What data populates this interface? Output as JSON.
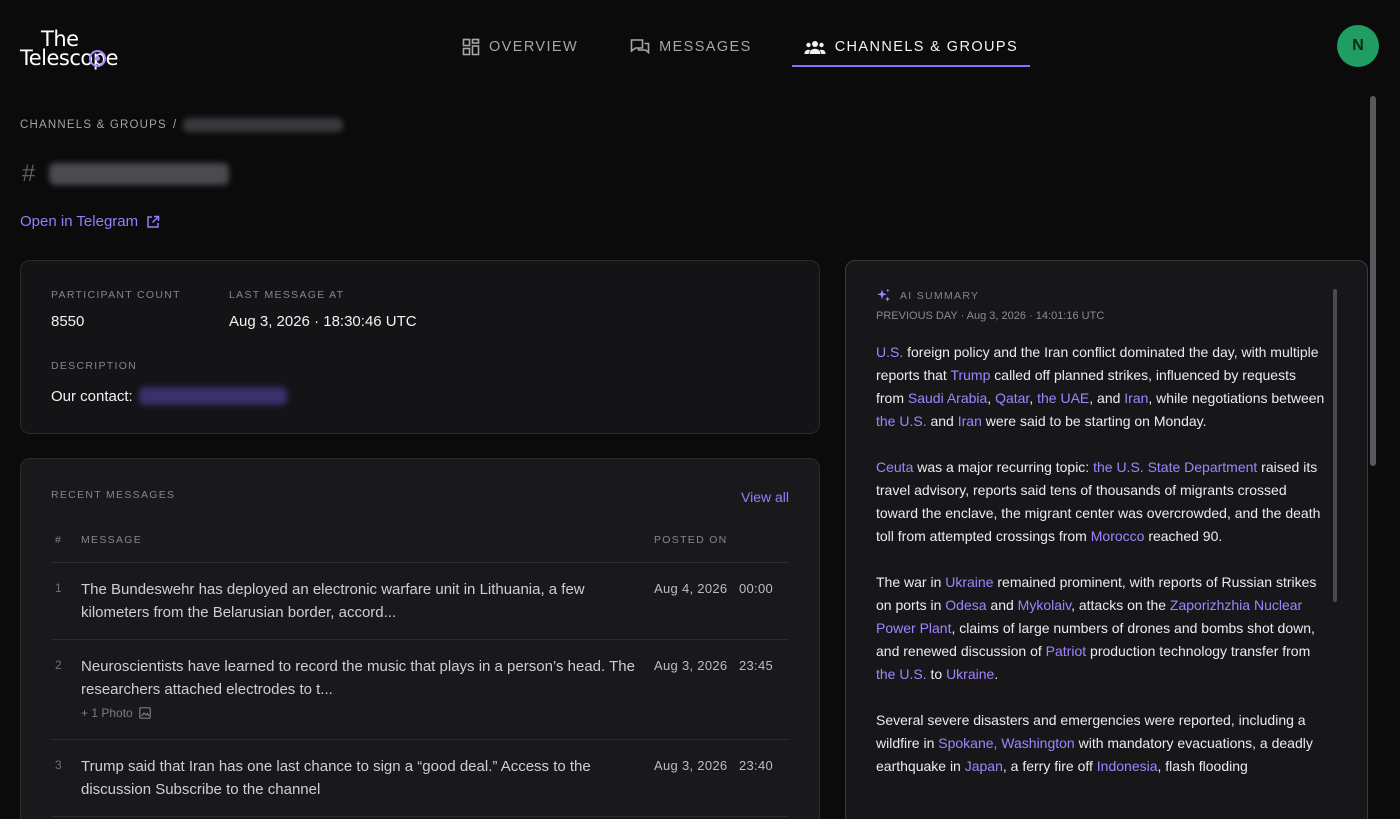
{
  "app": {
    "logo_line1": "The",
    "logo_line2": "Telescope",
    "accent_color": "#8f6bff"
  },
  "nav": {
    "items": [
      {
        "label": "OVERVIEW",
        "icon": "dashboard-icon",
        "active": false
      },
      {
        "label": "MESSAGES",
        "icon": "chat-bubbles-icon",
        "active": false
      },
      {
        "label": "CHANNELS & GROUPS",
        "icon": "users-group-icon",
        "active": true
      }
    ]
  },
  "user": {
    "initial": "N",
    "avatar_color": "#1f9d63"
  },
  "breadcrumb": {
    "root": "CHANNELS & GROUPS",
    "separator": "/"
  },
  "page": {
    "hash": "#",
    "open_link": "Open in Telegram"
  },
  "info": {
    "participant_label": "PARTICIPANT COUNT",
    "participant_value": "8550",
    "last_message_label": "LAST MESSAGE AT",
    "last_message_value": "Aug 3, 2026 · 18:30:46 UTC",
    "description_label": "DESCRIPTION",
    "description_value": "Our contact:"
  },
  "recent": {
    "title": "RECENT MESSAGES",
    "view_all": "View all",
    "columns": {
      "num": "#",
      "message": "MESSAGE",
      "posted": "POSTED ON"
    },
    "rows": [
      {
        "num": "1",
        "text": "The Bundeswehr has deployed an electronic warfare unit in Lithuania, a few kilometers from the Belarusian border, accord...",
        "date": "Aug 4, 2026",
        "time": "00:00",
        "attachment": ""
      },
      {
        "num": "2",
        "text": "Neuroscientists have learned to record the music that plays in a person’s head. The researchers attached electrodes to t...",
        "date": "Aug 3, 2026",
        "time": "23:45",
        "attachment": "+ 1 Photo"
      },
      {
        "num": "3",
        "text": "Trump said that Iran has one last chance to sign a “good deal.” Access to the discussion Subscribe to the channel",
        "date": "Aug 3, 2026",
        "time": "23:40",
        "attachment": ""
      }
    ]
  },
  "summary": {
    "title": "AI SUMMARY",
    "subtitle": "PREVIOUS DAY · Aug 3, 2026 · 14:01:16 UTC",
    "paragraphs": [
      [
        {
          "t": "U.S.",
          "e": true
        },
        {
          "t": " foreign policy and the Iran conflict dominated the day, with multiple reports that ",
          "e": false
        },
        {
          "t": "Trump",
          "e": true
        },
        {
          "t": " called off planned strikes, influenced by requests from ",
          "e": false
        },
        {
          "t": "Saudi Arabia",
          "e": true
        },
        {
          "t": ", ",
          "e": false
        },
        {
          "t": "Qatar",
          "e": true
        },
        {
          "t": ", ",
          "e": false
        },
        {
          "t": "the UAE",
          "e": true
        },
        {
          "t": ", and ",
          "e": false
        },
        {
          "t": "Iran",
          "e": true
        },
        {
          "t": ", while negotiations between ",
          "e": false
        },
        {
          "t": "the U.S.",
          "e": true
        },
        {
          "t": " and ",
          "e": false
        },
        {
          "t": "Iran",
          "e": true
        },
        {
          "t": " were said to be starting on Monday.",
          "e": false
        }
      ],
      [
        {
          "t": "Ceuta",
          "e": true
        },
        {
          "t": " was a major recurring topic: ",
          "e": false
        },
        {
          "t": "the U.S. State Department",
          "e": true
        },
        {
          "t": " raised its travel advisory, reports said tens of thousands of migrants crossed toward the enclave, the migrant center was overcrowded, and the death toll from attempted crossings from ",
          "e": false
        },
        {
          "t": "Morocco",
          "e": true
        },
        {
          "t": " reached 90.",
          "e": false
        }
      ],
      [
        {
          "t": "The war in ",
          "e": false
        },
        {
          "t": "Ukraine",
          "e": true
        },
        {
          "t": " remained prominent, with reports of Russian strikes on ports in ",
          "e": false
        },
        {
          "t": "Odesa",
          "e": true
        },
        {
          "t": " and ",
          "e": false
        },
        {
          "t": "Mykolaiv",
          "e": true
        },
        {
          "t": ", attacks on the ",
          "e": false
        },
        {
          "t": "Zaporizhzhia Nuclear Power Plant",
          "e": true
        },
        {
          "t": ", claims of large numbers of drones and bombs shot down, and renewed discussion of ",
          "e": false
        },
        {
          "t": "Patriot",
          "e": true
        },
        {
          "t": " production technology transfer from ",
          "e": false
        },
        {
          "t": "the U.S.",
          "e": true
        },
        {
          "t": " to ",
          "e": false
        },
        {
          "t": "Ukraine",
          "e": true
        },
        {
          "t": ".",
          "e": false
        }
      ],
      [
        {
          "t": "Several severe disasters and emergencies were reported, including a wildfire in ",
          "e": false
        },
        {
          "t": "Spokane, Washington",
          "e": true
        },
        {
          "t": " with mandatory evacuations, a deadly earthquake in ",
          "e": false
        },
        {
          "t": "Japan",
          "e": true
        },
        {
          "t": ", a ferry fire off ",
          "e": false
        },
        {
          "t": "Indonesia",
          "e": true
        },
        {
          "t": ", flash flooding",
          "e": false
        }
      ]
    ]
  }
}
